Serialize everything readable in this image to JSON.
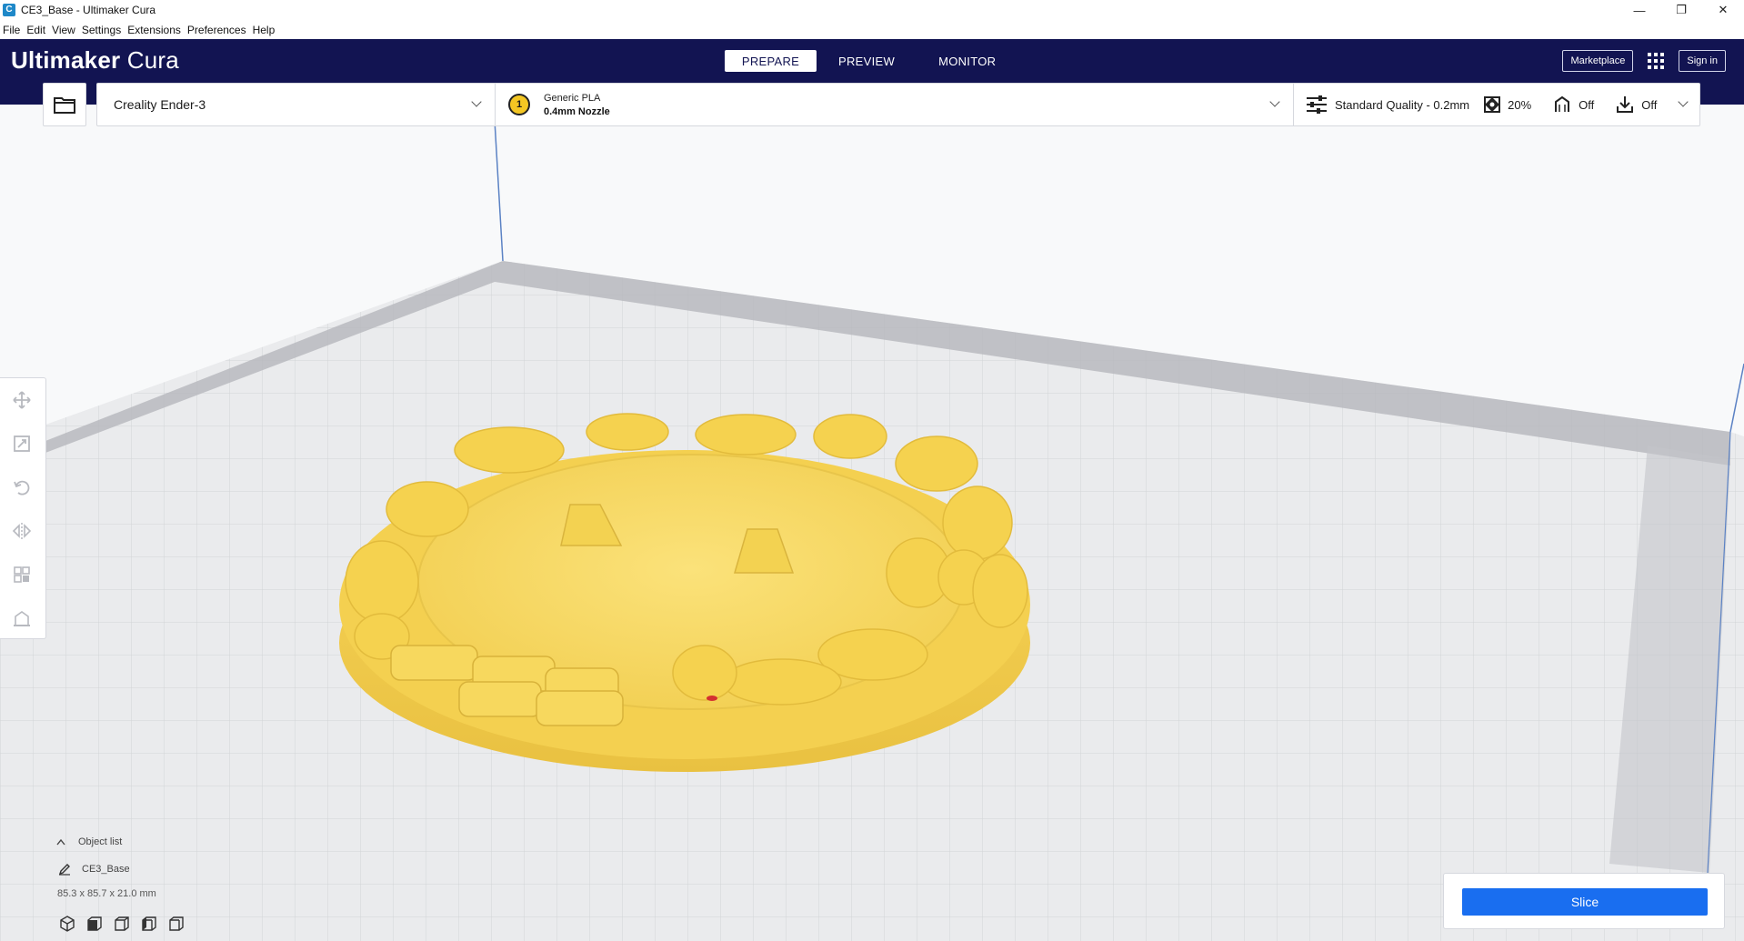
{
  "window": {
    "title": "CE3_Base - Ultimaker Cura",
    "app_icon": "cura-icon",
    "controls": [
      "minimize",
      "restore",
      "close"
    ]
  },
  "menu": [
    "File",
    "Edit",
    "View",
    "Settings",
    "Extensions",
    "Preferences",
    "Help"
  ],
  "header": {
    "logo_bold": "Ultimaker",
    "logo_light": "Cura",
    "stages": [
      "PREPARE",
      "PREVIEW",
      "MONITOR"
    ],
    "active_stage": "PREPARE",
    "marketplace_label": "Marketplace",
    "signin_label": "Sign in"
  },
  "toolbar": {
    "machine": "Creality Ender-3",
    "extruder_number": "1",
    "material": "Generic PLA",
    "nozzle": "0.4mm Nozzle",
    "quality": "Standard Quality - 0.2mm",
    "infill": "20%",
    "support": "Off",
    "adhesion": "Off"
  },
  "tools": [
    "move-tool-icon",
    "scale-tool-icon",
    "rotate-tool-icon",
    "mirror-tool-icon",
    "per-model-settings-icon",
    "support-blocker-icon"
  ],
  "object_list": {
    "header": "Object list",
    "object_name": "CE3_Base",
    "dimensions": "85.3 x 85.7 x 21.0 mm"
  },
  "slice": {
    "button_label": "Slice"
  },
  "colors": {
    "header_bg": "#121452",
    "accent_blue": "#196ef0",
    "model_yellow": "#f7d45a",
    "build_plate": "#eaebed"
  }
}
